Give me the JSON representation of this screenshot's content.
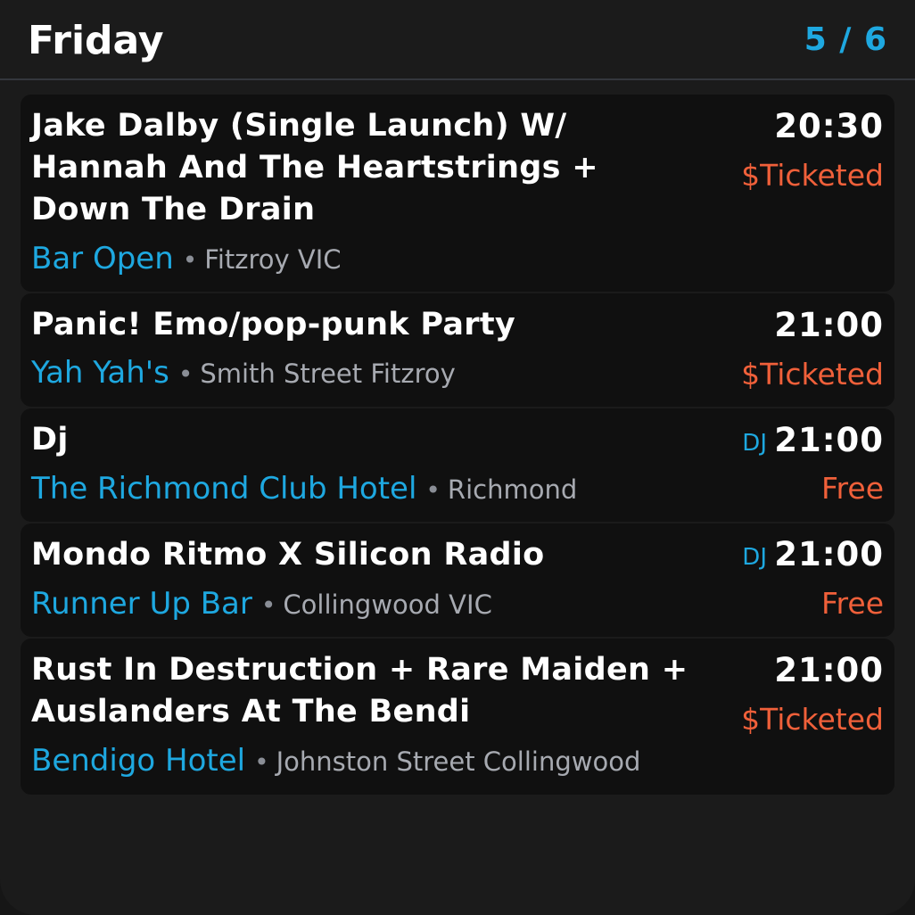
{
  "header": {
    "day": "Friday",
    "page_indicator": "5 / 6"
  },
  "colors": {
    "background": "#1b1b1b",
    "card": "#101010",
    "accent": "#1ea8e0",
    "price": "#f0603a",
    "text": "#ffffff",
    "muted": "#a7aab1"
  },
  "events": [
    {
      "title": "Jake Dalby (Single Launch) W/ Hannah And The Heartstrings + Down The Drain",
      "venue": "Bar Open",
      "separator": "•",
      "location": "Fitzroy VIC",
      "time": "20:30",
      "price": "$Ticketed",
      "tag": ""
    },
    {
      "title": "Panic! Emo/pop-punk Party",
      "venue": "Yah Yah's",
      "separator": "•",
      "location": "Smith Street Fitzroy",
      "time": "21:00",
      "price": "$Ticketed",
      "tag": ""
    },
    {
      "title": "Dj",
      "venue": "The Richmond Club Hotel",
      "separator": "•",
      "location": "Richmond",
      "time": "21:00",
      "price": "Free",
      "tag": "DJ"
    },
    {
      "title": "Mondo Ritmo X Silicon Radio",
      "venue": "Runner Up Bar",
      "separator": "•",
      "location": "Collingwood VIC",
      "time": "21:00",
      "price": "Free",
      "tag": "DJ"
    },
    {
      "title": "Rust In Destruction + Rare Maiden + Auslanders At The Bendi",
      "venue": "Bendigo Hotel",
      "separator": "•",
      "location": "Johnston Street Collingwood",
      "time": "21:00",
      "price": "$Ticketed",
      "tag": ""
    }
  ]
}
